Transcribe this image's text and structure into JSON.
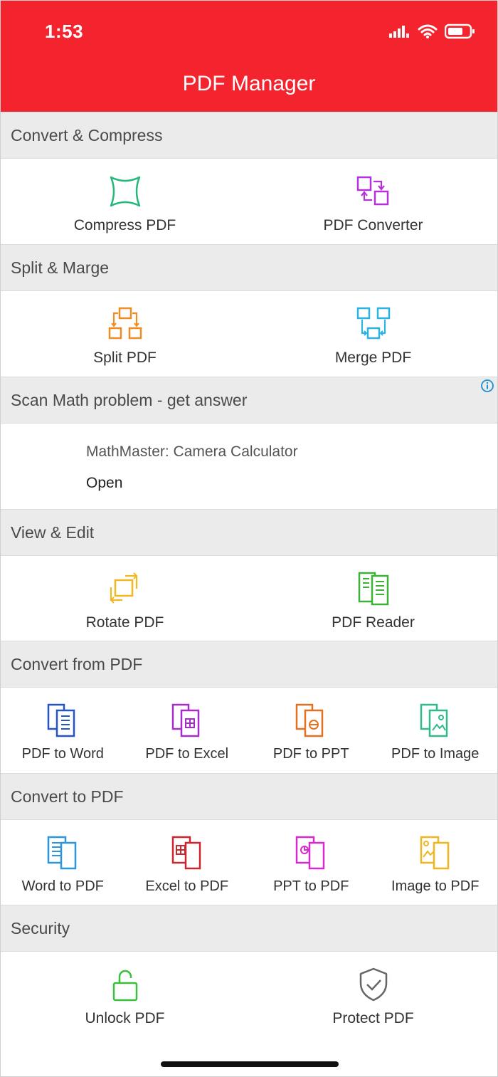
{
  "status_bar": {
    "time": "1:53"
  },
  "header": {
    "title": "PDF Manager"
  },
  "colors": {
    "header_bg": "#f4242e",
    "section_bg": "#ebebeb"
  },
  "sections": [
    {
      "title": "Convert & Compress",
      "items": [
        {
          "label": "Compress PDF",
          "icon": "compress-icon"
        },
        {
          "label": "PDF Converter",
          "icon": "converter-icon"
        }
      ]
    },
    {
      "title": "Split & Marge",
      "items": [
        {
          "label": "Split PDF",
          "icon": "split-icon"
        },
        {
          "label": "Merge PDF",
          "icon": "merge-icon"
        }
      ]
    },
    {
      "title": "View & Edit",
      "items": [
        {
          "label": "Rotate PDF",
          "icon": "rotate-icon"
        },
        {
          "label": "PDF Reader",
          "icon": "reader-icon"
        }
      ]
    },
    {
      "title": "Convert from PDF",
      "items": [
        {
          "label": "PDF to Word",
          "icon": "word-doc-icon"
        },
        {
          "label": "PDF to Excel",
          "icon": "excel-doc-icon"
        },
        {
          "label": "PDF to PPT",
          "icon": "ppt-doc-icon"
        },
        {
          "label": "PDF to Image",
          "icon": "image-doc-icon"
        }
      ]
    },
    {
      "title": "Convert to PDF",
      "items": [
        {
          "label": "Word to PDF",
          "icon": "word-doc-icon"
        },
        {
          "label": "Excel to PDF",
          "icon": "excel-doc-icon"
        },
        {
          "label": "PPT to PDF",
          "icon": "ppt-doc-icon"
        },
        {
          "label": "Image to PDF",
          "icon": "image-doc-icon"
        }
      ]
    },
    {
      "title": "Security",
      "items": [
        {
          "label": "Unlock PDF",
          "icon": "unlock-icon"
        },
        {
          "label": "Protect PDF",
          "icon": "shield-check-icon"
        }
      ]
    }
  ],
  "ad": {
    "title": "Scan Math problem - get answer",
    "app_name": "MathMaster: Camera Calculator",
    "action": "Open"
  }
}
